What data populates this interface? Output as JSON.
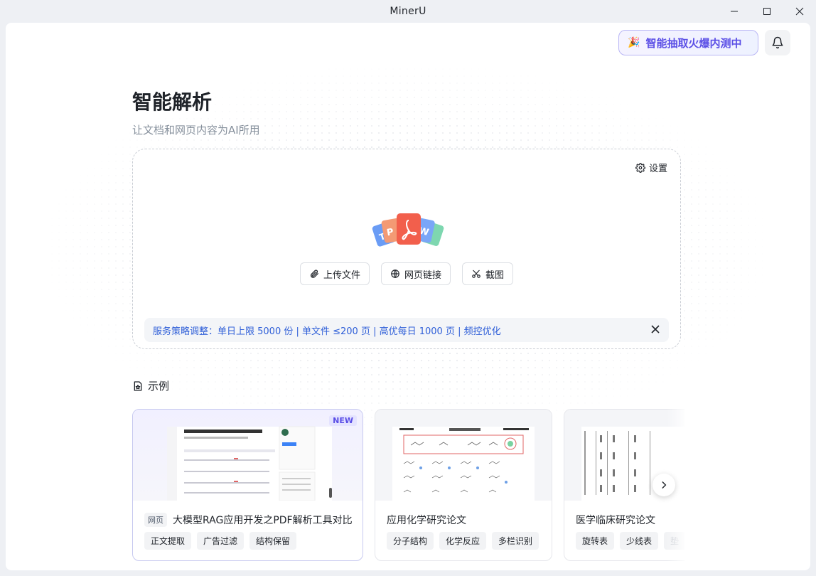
{
  "window": {
    "title": "MinerU"
  },
  "header": {
    "promo_label": "智能抽取火爆内测中",
    "title": "智能解析",
    "subtitle": "让文档和网页内容为AI所用"
  },
  "upload": {
    "settings_label": "设置",
    "actions": [
      {
        "label": "上传文件",
        "icon": "paperclip-icon"
      },
      {
        "label": "网页链接",
        "icon": "globe-icon"
      },
      {
        "label": "截图",
        "icon": "scissors-icon"
      }
    ],
    "notice": "服务策略调整：单日上限 5000 份 | 单文件 ≤200 页 | 高优每日 1000 页 | 频控优化"
  },
  "examples": {
    "heading": "示例",
    "cards": [
      {
        "badge": "NEW",
        "type_tag": "网页",
        "title": "大模型RAG应用开发之PDF解析工具对比",
        "tags": [
          "正文提取",
          "广告过滤",
          "结构保留"
        ]
      },
      {
        "title": "应用化学研究论文",
        "tags": [
          "分子结构",
          "化学反应",
          "多栏识别"
        ]
      },
      {
        "title": "医学临床研究论文",
        "tags": [
          "旋转表",
          "少线表",
          "垫"
        ]
      }
    ]
  },
  "colors": {
    "accent": "#5a4ee6",
    "notice_text": "#2f5fd8",
    "pdf_red": "#f25f4c"
  }
}
